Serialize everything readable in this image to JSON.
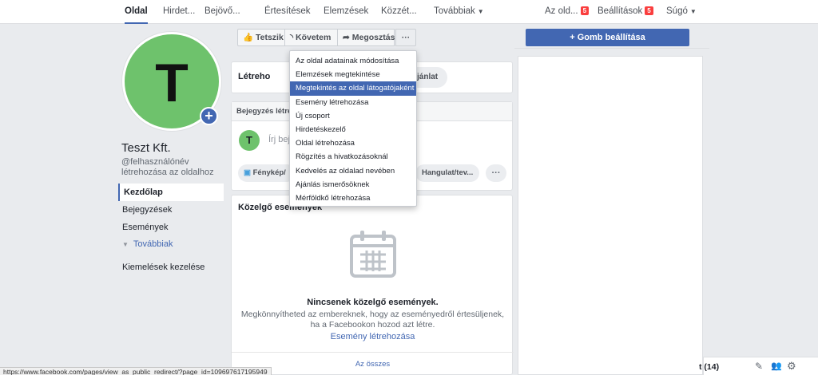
{
  "topnav": {
    "tabs": [
      {
        "label": "Oldal"
      },
      {
        "label": "Hirdet..."
      },
      {
        "label": "Bejövő..."
      },
      {
        "label": "Értesítések"
      },
      {
        "label": "Elemzések"
      },
      {
        "label": "Közzét..."
      },
      {
        "label": "Továbbiak"
      }
    ],
    "right": {
      "page_roles": "Az old...",
      "page_roles_badge": "5",
      "settings": "Beállítások",
      "settings_badge": "5",
      "help": "Súgó"
    }
  },
  "profile": {
    "initial": "T",
    "page_name": "Teszt Kft.",
    "username_prompt": "@felhasználónév létrehozása az oldalhoz"
  },
  "leftnav": {
    "items": [
      "Kezdőlap",
      "Bejegyzések",
      "Események"
    ],
    "more": "Továbbiak",
    "manage_highlights": "Kiemelések kezelése"
  },
  "action_bar": {
    "like": "Tetszik",
    "follow": "Követem",
    "share": "Megosztás",
    "more": "···",
    "cta": "+ Gomb beállítása"
  },
  "create_card": {
    "label": "Létreho",
    "offer": "jánlat"
  },
  "post_card": {
    "header": "Bejegyzés létreh",
    "avatar_initial": "T",
    "placeholder": "Írj beje",
    "photo": "Fénykép/",
    "feeling": "Hangulat/tev...",
    "more": "···"
  },
  "events": {
    "title": "Közelgő események",
    "empty_title": "Nincsenek közelgő események.",
    "empty_line1": "Megkönnyítheted az embereknek, hogy az eseményedről értesüljenek,",
    "empty_line2": "ha a Facebookon hozod azt létre.",
    "create_link": "Esemény létrehozása",
    "see_all": "Az összes"
  },
  "dropdown": {
    "items": [
      "Az oldal adatainak módosítása",
      "Elemzések megtekintése",
      "Megtekintés az oldal látogatójaként",
      "Esemény létrehozása",
      "Új csoport",
      "Hirdetéskezelő",
      "Oldal létrehozása",
      "Rögzítés a hivatkozásoknál",
      "Kedvelés az oldalad nevében",
      "Ajánlás ismerősöknek",
      "Mérföldkő létrehozása"
    ],
    "highlighted_index": 2
  },
  "chat": {
    "label": "t (14)"
  },
  "status_url": "https://www.facebook.com/pages/view_as_public_redirect/?page_id=109697617195949",
  "colors": {
    "brand": "#4267b2",
    "avatar_green": "#6ec26c",
    "badge_red": "#fa3e3e"
  }
}
